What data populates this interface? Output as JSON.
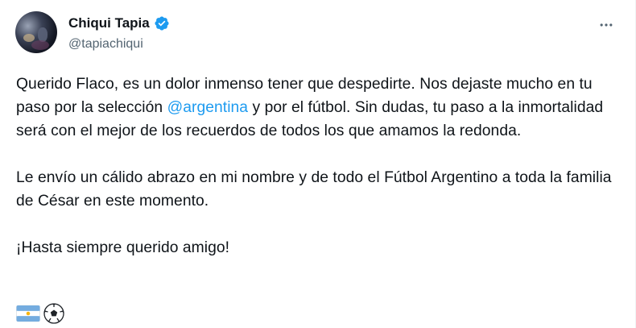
{
  "user": {
    "display_name": "Chiqui Tapia",
    "handle": "@tapiachiqui",
    "verified": true
  },
  "tweet": {
    "paragraph1_part1": "Querido Flaco, es un dolor inmenso tener que despedirte. Nos dejaste mucho en tu paso por la selección ",
    "mention": "@argentina",
    "paragraph1_part2": " y por el fútbol. Sin dudas, tu paso a la inmortalidad será con el mejor de los recuerdos de todos los que amamos la redonda.",
    "paragraph2": "Le envío un cálido abrazo en mi nombre y de todo el Fútbol Argentino a toda la familia de César en este momento.",
    "paragraph3": "¡Hasta siempre querido amigo!",
    "emojis": [
      "argentina-flag-emoji",
      "soccer-ball-emoji"
    ]
  },
  "icons": {
    "verified": "verified-badge-icon",
    "more": "more-options-icon"
  },
  "colors": {
    "text": "#0f1419",
    "secondary": "#536471",
    "accent": "#1d9bf0",
    "flag_blue": "#74acdf"
  }
}
